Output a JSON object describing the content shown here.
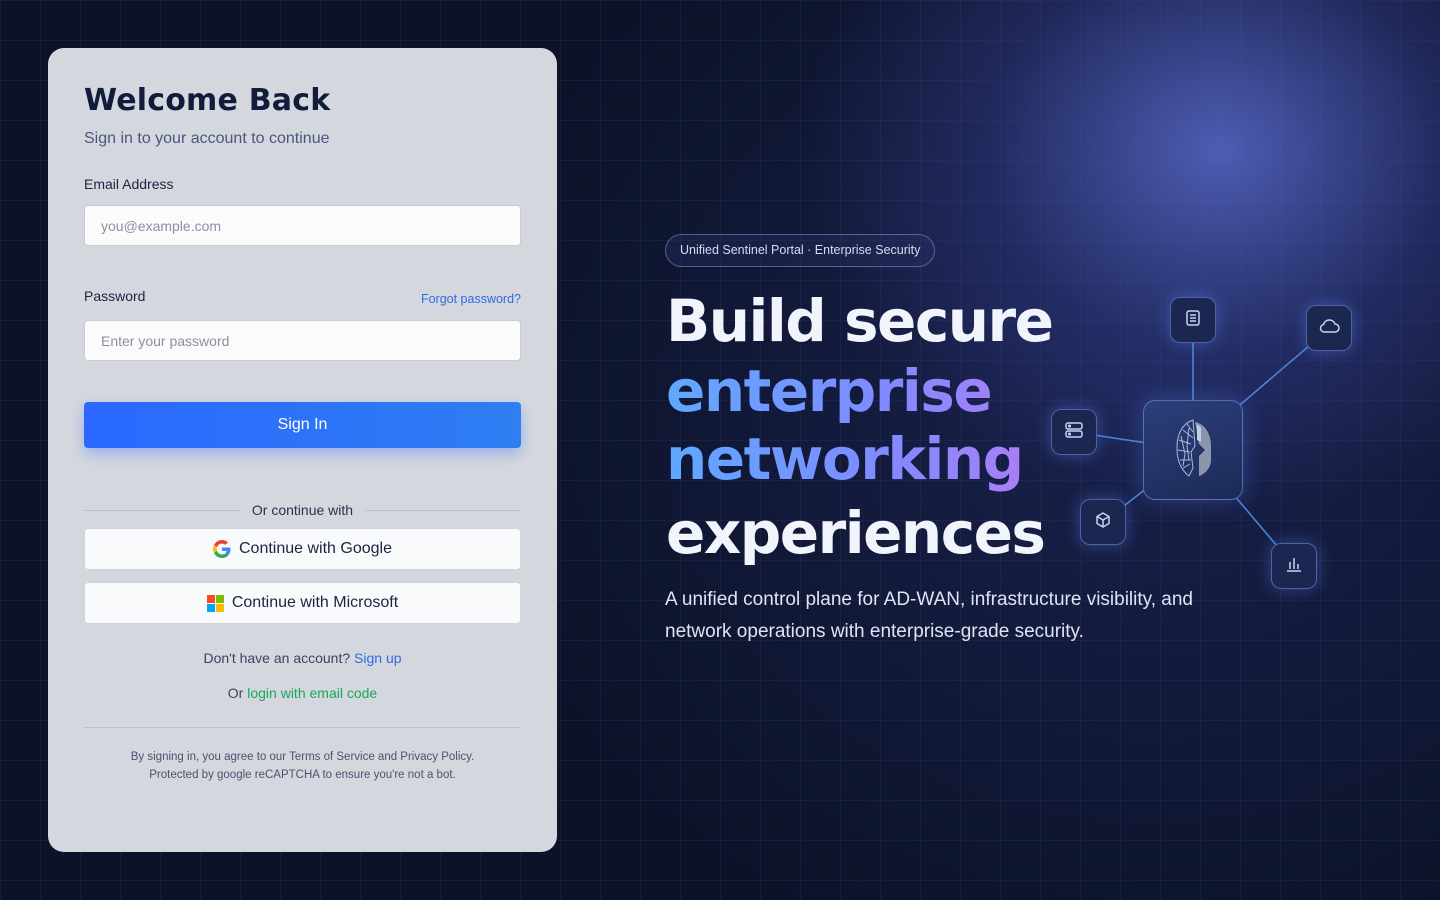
{
  "login": {
    "title": "Welcome Back",
    "subtitle": "Sign in to your account to continue",
    "email_label": "Email Address",
    "email_placeholder": "you@example.com",
    "password_label": "Password",
    "forgot_link": "Forgot password?",
    "password_placeholder": "Enter your password",
    "signin_button": "Sign In",
    "divider_text": "Or continue with",
    "google_button": "Continue with Google",
    "microsoft_button": "Continue with Microsoft",
    "no_account_text": "Don't have an account?",
    "signup_link": "Sign up",
    "email_code_prefix": "Or",
    "email_code_link": "login with email code",
    "legal_line1": "By signing in, you agree to our Terms of Service and Privacy Policy.",
    "legal_line2": "Protected by google reCAPTCHA to ensure you're not a bot."
  },
  "hero": {
    "badge": "Unified Sentinel Portal · Enterprise Security",
    "headline_line1": "Build secure",
    "headline_line2": "enterprise",
    "headline_line3": "networking",
    "headline_line4": "experiences",
    "description": "A unified control plane for AD-WAN, infrastructure visibility, and network operations with enterprise-grade security."
  },
  "diagram": {
    "hub_icon": "spartan-helmet-icon",
    "nodes": [
      "document-icon",
      "cloud-icon",
      "server-icon",
      "cube-icon",
      "bar-chart-icon"
    ]
  },
  "colors": {
    "primary": "#2a68ff",
    "link": "#2e6be0",
    "success_link": "#17a85a",
    "background": "#0c1228",
    "card": "#d4d8de"
  }
}
